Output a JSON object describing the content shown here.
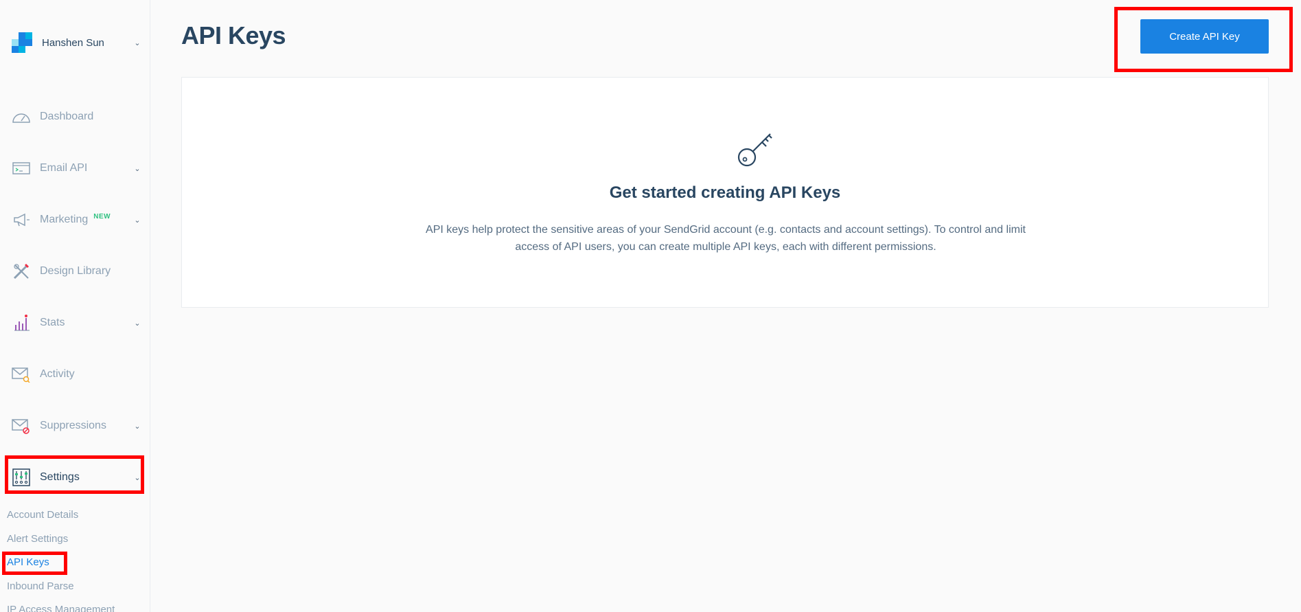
{
  "account": {
    "name": "Hanshen Sun"
  },
  "sidebar": {
    "items": [
      {
        "label": "Dashboard",
        "icon": "dashboard-icon",
        "has_chevron": false
      },
      {
        "label": "Email API",
        "icon": "email-api-icon",
        "has_chevron": true
      },
      {
        "label": "Marketing",
        "icon": "megaphone-icon",
        "has_chevron": true,
        "badge": "NEW"
      },
      {
        "label": "Design Library",
        "icon": "design-library-icon",
        "has_chevron": false
      },
      {
        "label": "Stats",
        "icon": "stats-icon",
        "has_chevron": true
      },
      {
        "label": "Activity",
        "icon": "activity-icon",
        "has_chevron": false
      },
      {
        "label": "Suppressions",
        "icon": "suppressions-icon",
        "has_chevron": true
      },
      {
        "label": "Settings",
        "icon": "settings-icon",
        "has_chevron": true
      }
    ],
    "settings_subitems": [
      {
        "label": "Account Details"
      },
      {
        "label": "Alert Settings"
      },
      {
        "label": "API Keys",
        "active": true
      },
      {
        "label": "Inbound Parse"
      },
      {
        "label": "IP Access Management"
      }
    ]
  },
  "main": {
    "title": "API Keys",
    "create_button": "Create API Key",
    "empty_state": {
      "icon": "key-icon",
      "title": "Get started creating API Keys",
      "description": "API keys help protect the sensitive areas of your SendGrid account (e.g. contacts and account settings). To control and limit access of API users, you can create multiple API keys, each with different permissions."
    }
  },
  "colors": {
    "accent": "#1a82e2",
    "text_dark": "#294661",
    "text_muted": "#8da1b4",
    "new_badge": "#30c181",
    "highlight": "#ff0000"
  }
}
